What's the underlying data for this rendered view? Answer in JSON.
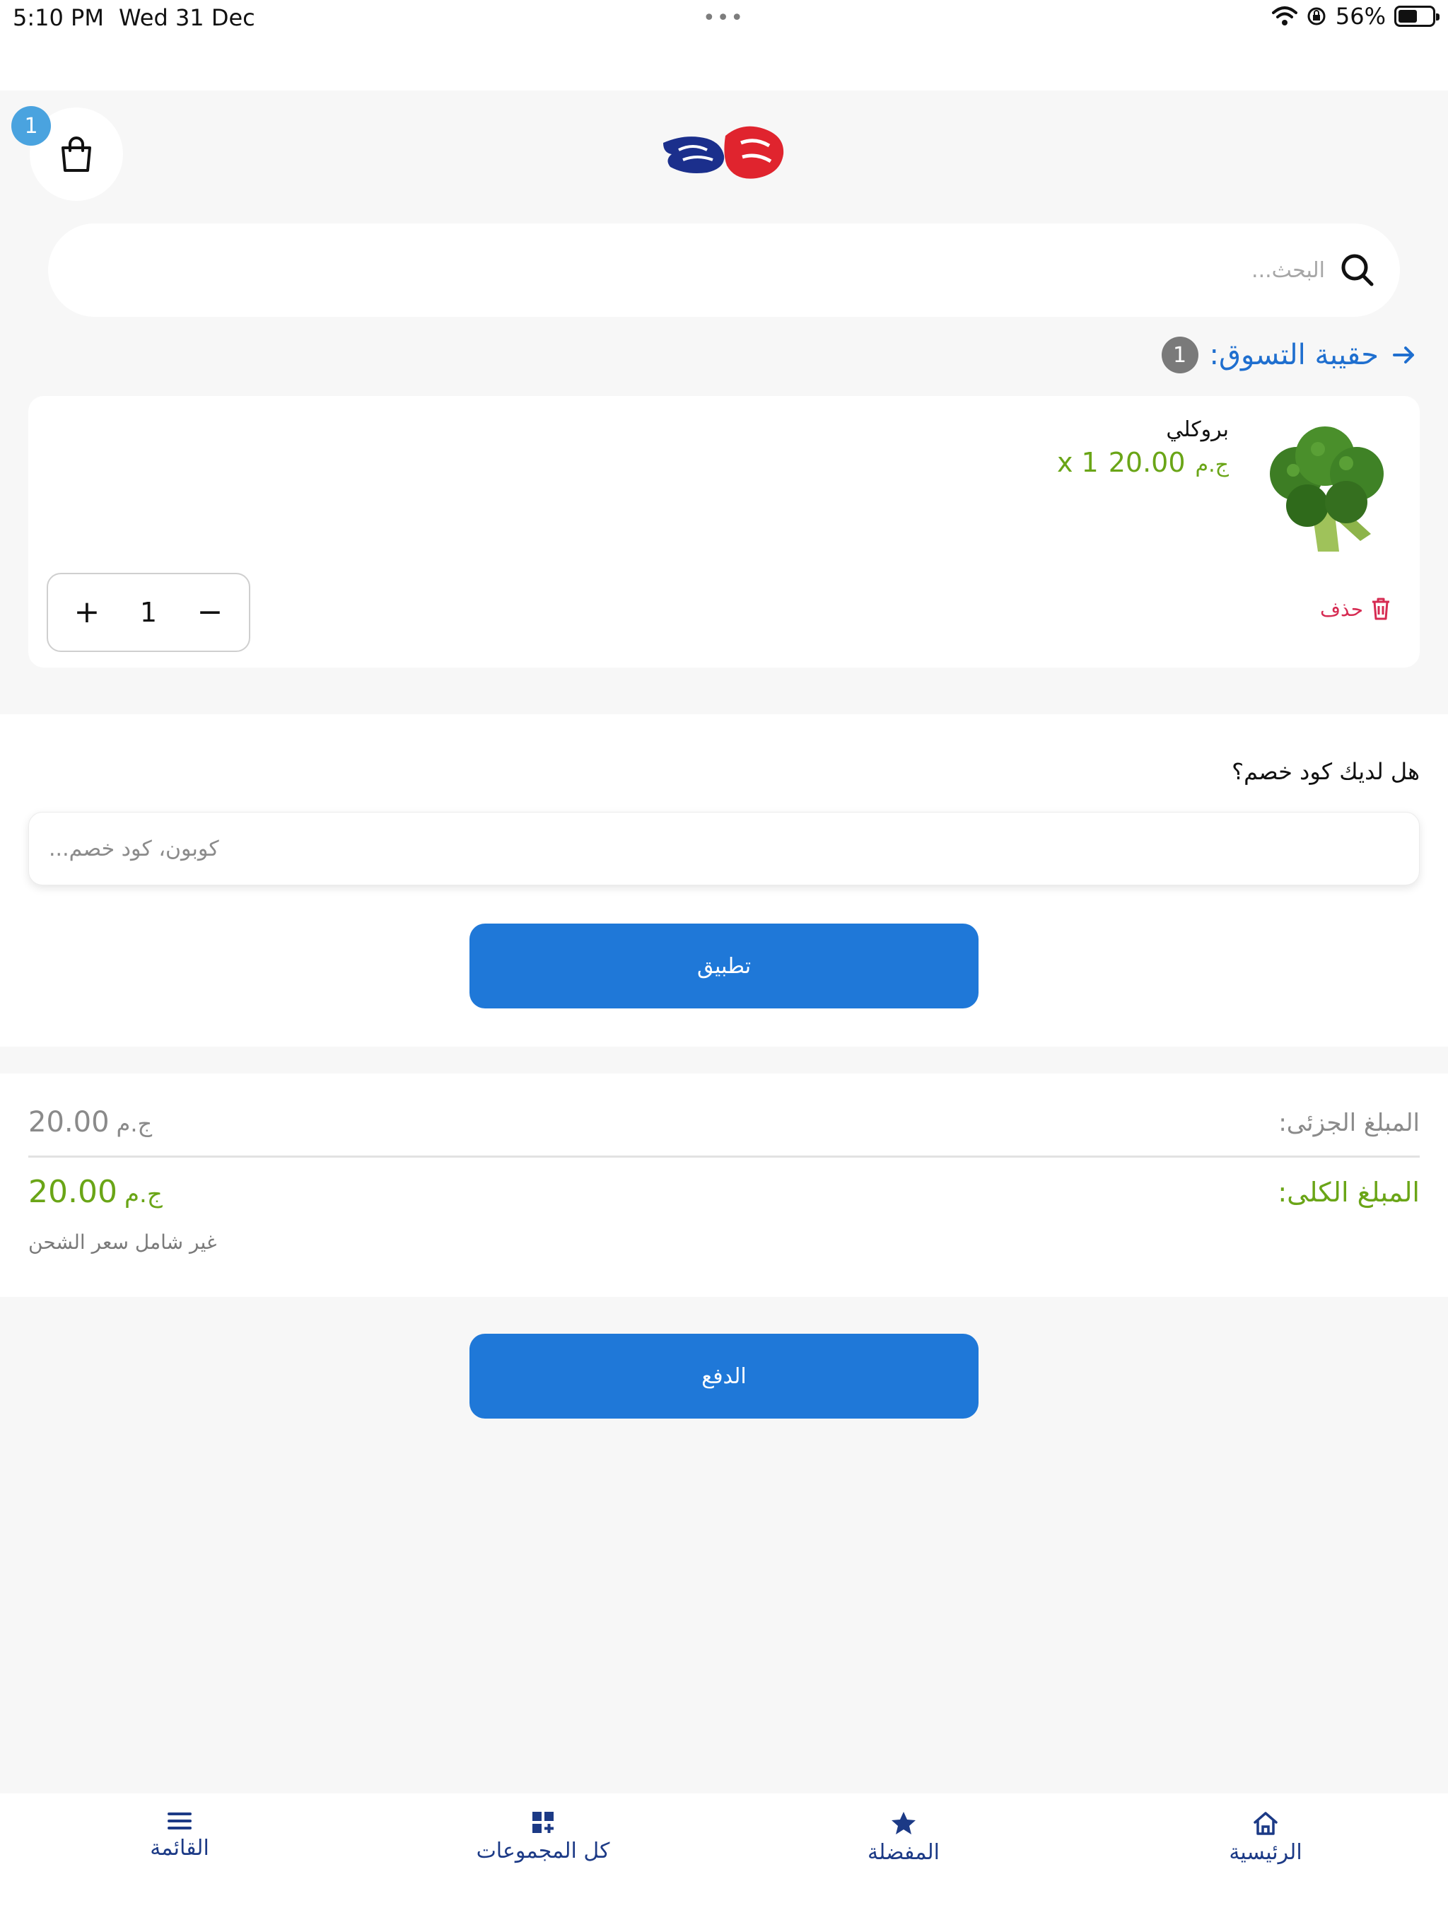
{
  "status_bar": {
    "time": "5:10 PM",
    "date": "Wed 31 Dec",
    "dots": "•••",
    "battery": "56%",
    "battery_level": 0.56
  },
  "header": {
    "cart_badge": "1",
    "icons": {
      "cart": "shopping-bag-icon",
      "logo": "store-logo"
    }
  },
  "search": {
    "placeholder": "البحث..."
  },
  "cart": {
    "title": "حقيبة التسوق:",
    "count": "1"
  },
  "product": {
    "name": "بروكلي",
    "currency": "ج.م",
    "price": "20.00",
    "qty_label": "1 x",
    "delete_label": "حذف",
    "quantity": "1",
    "minus": "−",
    "plus": "+"
  },
  "coupon": {
    "question": "هل لديك كود خصم؟",
    "placeholder": "كوبون، كود خصم...",
    "apply_label": "تطبيق"
  },
  "totals": {
    "subtotal_label": "المبلغ الجزئى:",
    "subtotal_value": "20.00",
    "total_label": "المبلغ الكلى:",
    "total_value": "20.00",
    "currency": "ج.م",
    "shipping_note": "غير شامل سعر الشحن"
  },
  "pay": {
    "label": "الدفع"
  },
  "bottom_nav": {
    "menu": "القائمة",
    "collections": "كل المجموعات",
    "favorites": "المفضلة",
    "home": "الرئيسية"
  },
  "colors": {
    "primary": "#1f78d8",
    "title_blue": "#1f6fcf",
    "price_green": "#6aa517",
    "delete_red": "#d62b52",
    "nav_navy": "#1c3a86",
    "badge_blue": "#4aa3df"
  }
}
